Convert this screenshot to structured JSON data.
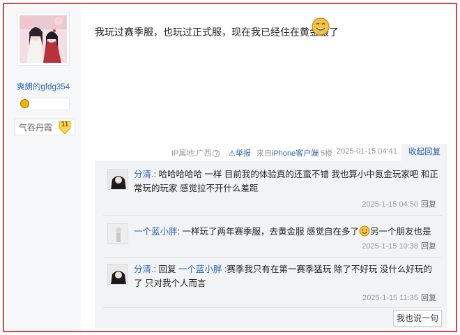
{
  "user": {
    "username": "爽朗的gfdg354",
    "level_name": "气吞丹霞",
    "level_number": "11"
  },
  "post": {
    "text": "我玩过赛季服，也玩过正式服，现在我已经住在黄金服了",
    "ip_label": "IP属地:广西",
    "report_label": "举报",
    "source_prefix": "来自",
    "source_client": "iPhone客户端",
    "floor": "5楼",
    "time": "2025-01-15 04:41",
    "collapse_label": "收起回复"
  },
  "replies": [
    {
      "author": "分清.",
      "sep": ":",
      "text": " 哈哈哈哈哈 一样 目前我的体验真的还蛮不错 我也算小中氪金玩家吧 和正常玩的玩家 感觉拉不开什么差距",
      "time": "2025-1-15 04:50",
      "reply_label": "回复"
    },
    {
      "author": "一个蓝小胖",
      "sep": ":",
      "text_before": " 一样玩了两年赛季服，去黄金服 感觉自在多了",
      "text_after": "另一个朋友也是",
      "time": "2025-1-15 10:38",
      "reply_label": "回复"
    },
    {
      "author": "分清.",
      "sep": ":",
      "reply_prefix": " 回复 ",
      "reply_target": "一个蓝小胖",
      "text": " :赛季我只有在第一赛季猛玩 除了不好玩 没什么好玩的了 只对我个人而言",
      "time": "2025-1-15 11:35",
      "reply_label": "回复"
    }
  ],
  "say_button": "我也说一句",
  "colors": {
    "link": "#2d64b3",
    "border": "#e0413a",
    "reply_bg": "#f2f3f5"
  }
}
